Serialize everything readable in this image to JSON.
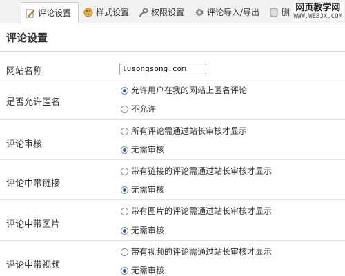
{
  "tabs": [
    {
      "label": "评论设置",
      "icon": "pencil-icon",
      "active": true
    },
    {
      "label": "样式设置",
      "icon": "palette-icon",
      "active": false
    },
    {
      "label": "权限设置",
      "icon": "wrench-icon",
      "active": false
    },
    {
      "label": "评论导入/导出",
      "icon": "gear-icon",
      "active": false
    },
    {
      "label": "删",
      "icon": "database-icon",
      "active": false
    }
  ],
  "watermark": {
    "title": "网页教学网",
    "url": "WWW.WEBJX.COM"
  },
  "page_title": "评论设置",
  "site_name": {
    "label": "网站名称",
    "value": "lusongsong.com"
  },
  "anonymous": {
    "label": "是否允许匿名",
    "options": [
      "允许用户在我的网站上匿名评论",
      "不允许"
    ],
    "selected": 0
  },
  "review": {
    "label": "评论审核",
    "options": [
      "所有评论需通过站长审核才显示",
      "无需审核"
    ],
    "selected": 1
  },
  "links": {
    "label": "评论中带链接",
    "options": [
      "带有链接的评论需通过站长审核才显示",
      "无需审核"
    ],
    "selected": 1
  },
  "images": {
    "label": "评论中带图片",
    "options": [
      "带有图片的评论需通过站长审核才显示",
      "无需审核"
    ],
    "selected": 1
  },
  "videos": {
    "label": "评论中带视频",
    "options": [
      "带有视频的评论需通过站长审核才显示",
      "无需审核"
    ],
    "selected": 1
  }
}
